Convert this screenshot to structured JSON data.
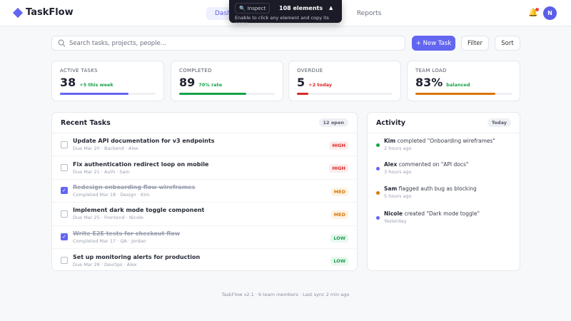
{
  "header": {
    "brand": "TaskFlow",
    "nav": [
      {
        "label": "Dashboard",
        "active": true
      },
      {
        "label": "Reports",
        "active": false
      }
    ],
    "user_initial": "N",
    "notification_icon": "bell-icon"
  },
  "inspector": {
    "button_label": "Inspect",
    "count": "108 elements",
    "hint": "Enable to click any element and copy its name"
  },
  "toolbar": {
    "search_placeholder": "Search tasks, projects, people...",
    "new_task": "+ New Task",
    "filter": "Filter",
    "sort": "Sort"
  },
  "stats": [
    {
      "label": "ACTIVE TASKS",
      "value": "38",
      "sub": "+5 this week",
      "sub_color": "#16a34a",
      "bar_color": "#6366f1",
      "progress": 0.72
    },
    {
      "label": "COMPLETED",
      "value": "89",
      "sub": "70% rate",
      "sub_color": "#16a34a",
      "bar_color": "#16a34a",
      "progress": 0.7
    },
    {
      "label": "OVERDUE",
      "value": "5",
      "sub": "+2 today",
      "sub_color": "#dc2626",
      "bar_color": "#dc2626",
      "progress": 0.12
    },
    {
      "label": "TEAM LOAD",
      "value": "83%",
      "sub": "balanced",
      "sub_color": "#16a34a",
      "bar_color": "#d97706",
      "progress": 0.83
    }
  ],
  "tasks": {
    "title": "Recent Tasks",
    "badge": "12 open",
    "items": [
      {
        "title": "Update API documentation for v3 endpoints",
        "meta": "Due Mar 20 · Backend · Alex",
        "priority": "HIGH",
        "done": false
      },
      {
        "title": "Fix authentication redirect loop on mobile",
        "meta": "Due Mar 21 · Auth · Sam",
        "priority": "HIGH",
        "done": false
      },
      {
        "title": "Redesign onboarding flow wireframes",
        "meta": "Completed Mar 18 · Design · Kim",
        "priority": "MED",
        "done": true
      },
      {
        "title": "Implement dark mode toggle component",
        "meta": "Due Mar 25 · Frontend · Nicole",
        "priority": "MED",
        "done": false
      },
      {
        "title": "Write E2E tests for checkout flow",
        "meta": "Completed Mar 17 · QA · Jordan",
        "priority": "LOW",
        "done": true
      },
      {
        "title": "Set up monitoring alerts for production",
        "meta": "Due Mar 28 · DevOps · Alex",
        "priority": "LOW",
        "done": false
      }
    ]
  },
  "priority_colors": {
    "HIGH": {
      "fg": "#dc2626",
      "bg": "#fdecec"
    },
    "MED": {
      "fg": "#d97706",
      "bg": "#fdf3e3"
    },
    "LOW": {
      "fg": "#16a34a",
      "bg": "#e9f7ee"
    }
  },
  "activity": {
    "title": "Activity",
    "badge": "Today",
    "items": [
      {
        "user": "Kim",
        "text": " completed \"Onboarding wireframes\"",
        "time": "2 hours ago",
        "color": "#16a34a"
      },
      {
        "user": "Alex",
        "text": " commented on \"API docs\"",
        "time": "3 hours ago",
        "color": "#6366f1"
      },
      {
        "user": "Sam",
        "text": " flagged auth bug as blocking",
        "time": "5 hours ago",
        "color": "#d97706"
      },
      {
        "user": "Nicole",
        "text": " created \"Dark mode toggle\"",
        "time": "Yesterday",
        "color": "#6366f1"
      }
    ]
  },
  "footer": "TaskFlow v2.1 · 6 team members · Last sync 2 min ago"
}
